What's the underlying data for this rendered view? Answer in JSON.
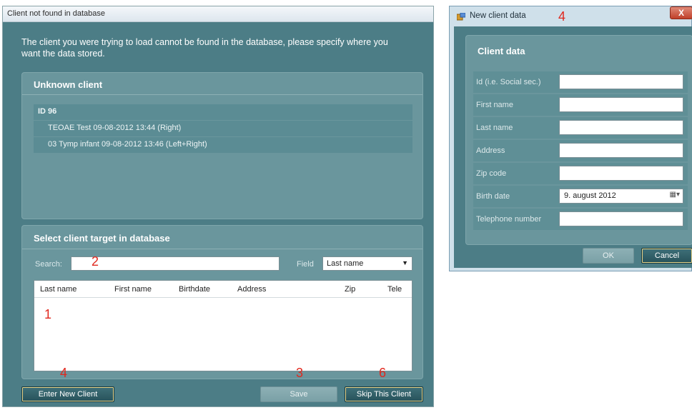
{
  "left_dialog": {
    "title": "Client not found in database",
    "message": "The client you were trying to load cannot be found in the database, please specify where you want the data stored.",
    "unknown_client": {
      "title": "Unknown client",
      "id_label": "ID 96",
      "sessions": [
        "TEOAE Test 09-08-2012 13:44 (Right)",
        "03 Tymp infant 09-08-2012 13:46 (Left+Right)"
      ]
    },
    "target": {
      "title": "Select client target in database",
      "search_label": "Search:",
      "search_value": "",
      "field_label": "Field",
      "field_value": "Last name",
      "columns": [
        "Last name",
        "First name",
        "Birthdate",
        "Address",
        "Zip",
        "Tele"
      ]
    },
    "buttons": {
      "enter_new_client": "Enter New Client",
      "save": "Save",
      "skip": "Skip This Client"
    }
  },
  "right_dialog": {
    "title": "New client data",
    "group_title": "Client data",
    "fields": [
      {
        "label": "Id (i.e. Social sec.)",
        "value": ""
      },
      {
        "label": "First name",
        "value": ""
      },
      {
        "label": "Last name",
        "value": ""
      },
      {
        "label": "Address",
        "value": ""
      },
      {
        "label": "Zip code",
        "value": ""
      },
      {
        "label": "Birth date",
        "value": "9.   august   2012"
      },
      {
        "label": "Telephone number",
        "value": ""
      }
    ],
    "ok_label": "OK",
    "cancel_label": "Cancel",
    "close_glyph": "X"
  },
  "annotations": {
    "grid": "1",
    "search": "2",
    "save": "3",
    "enter_new": "4",
    "skip": "6",
    "new_client_title": "4"
  },
  "colors": {
    "dialog_bg": "#4c7d86",
    "group_bg": "#6a969d",
    "annotation": "#e0281e"
  }
}
